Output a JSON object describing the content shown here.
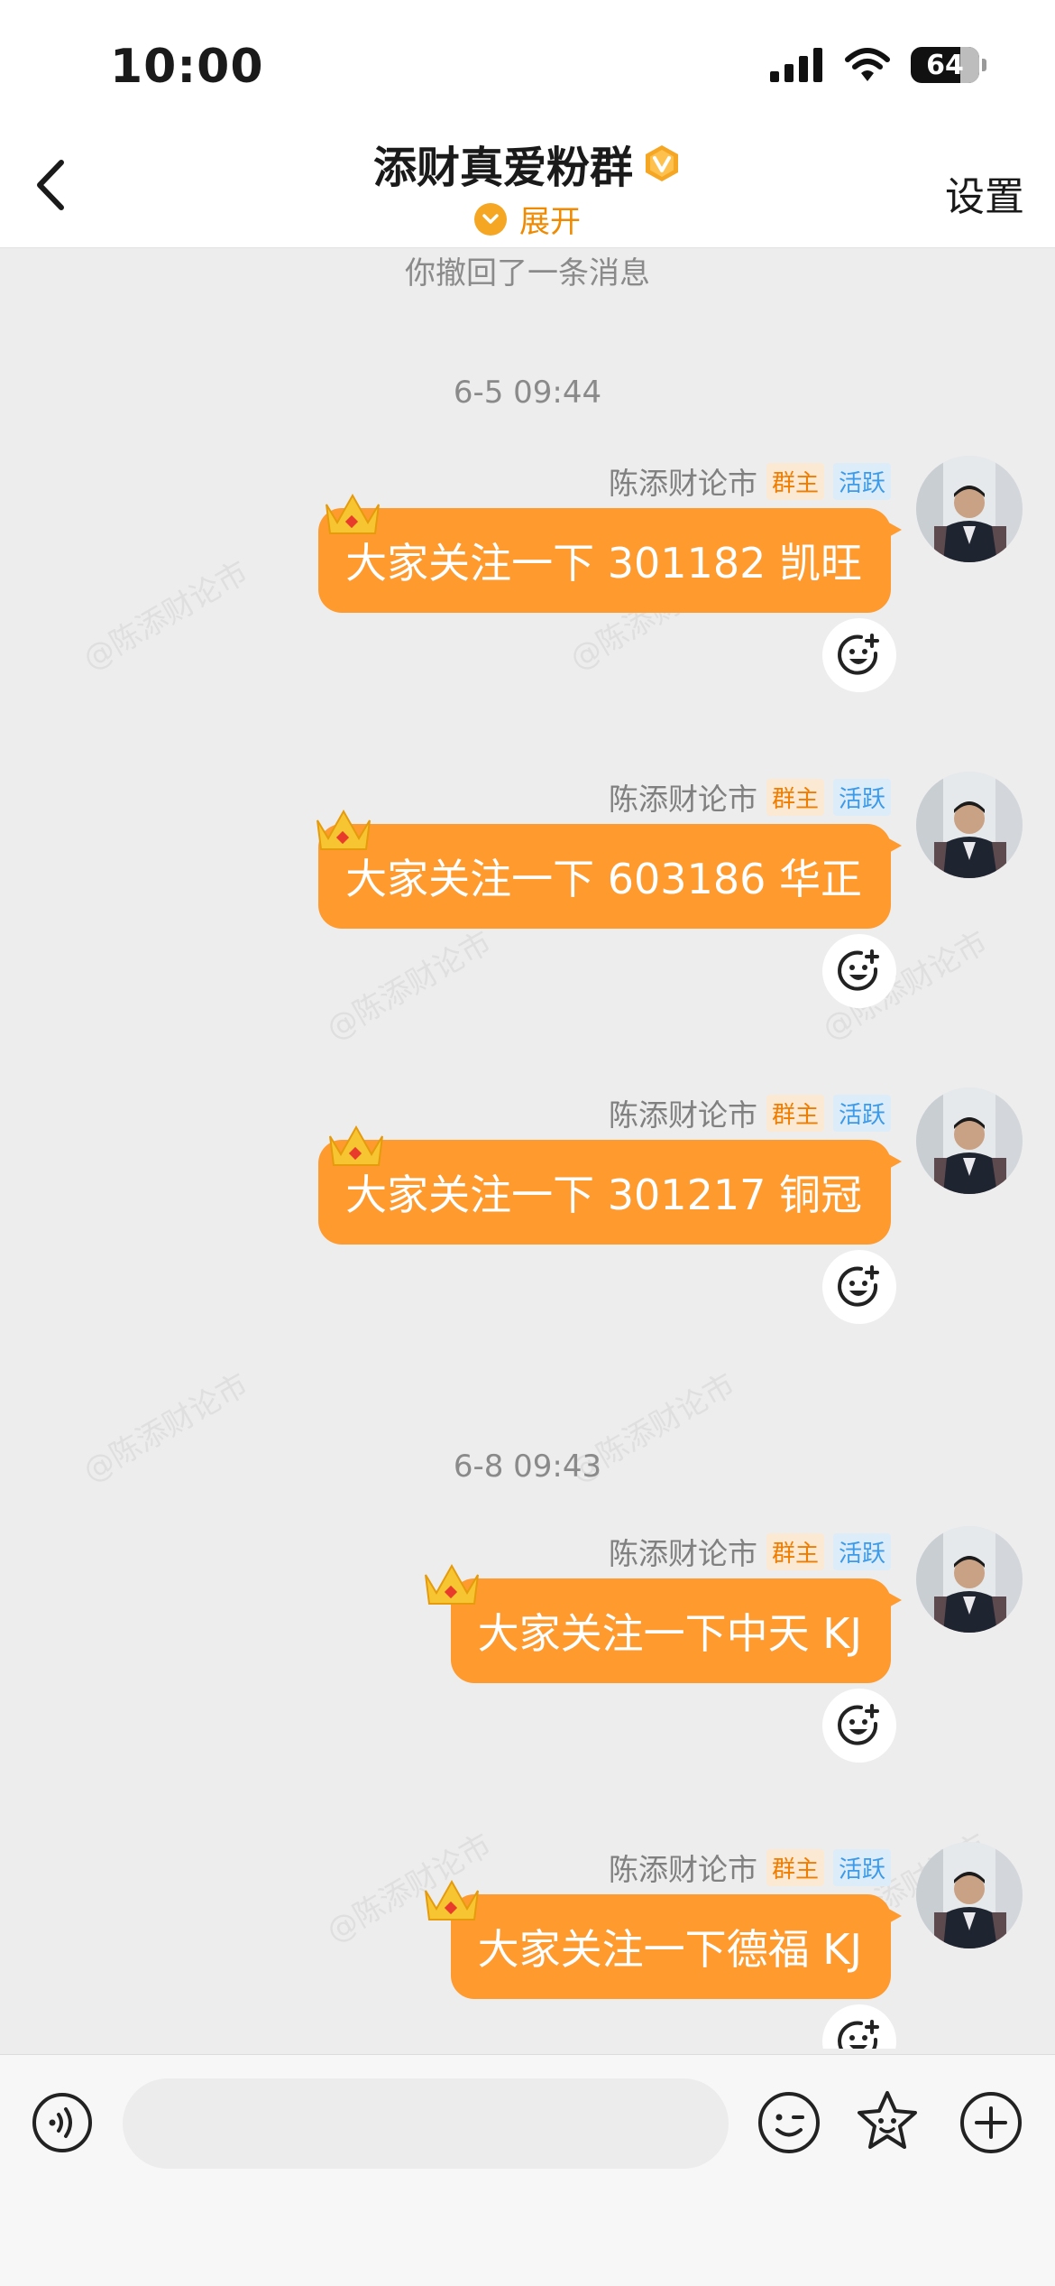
{
  "status_bar": {
    "time": "10:00",
    "battery": "64",
    "icons": [
      "signal-icon",
      "wifi-icon",
      "battery-icon"
    ]
  },
  "header": {
    "title": "添财真爱粉群",
    "expand_label": "展开",
    "settings_label": "设置",
    "back_icon": "chevron-left-icon",
    "badge_icon": "verified-v-icon"
  },
  "chat": {
    "recalled_notice": "你撤回了一条消息",
    "timestamps": [
      "6-5 09:44",
      "6-8 09:43"
    ],
    "watermark": "@陈添财论市",
    "messages": [
      {
        "sender": "陈添财论市",
        "tag_owner": "群主",
        "tag_active": "活跃",
        "text": "大家关注一下 301182 凯旺"
      },
      {
        "sender": "陈添财论市",
        "tag_owner": "群主",
        "tag_active": "活跃",
        "text": "大家关注一下 603186 华正"
      },
      {
        "sender": "陈添财论市",
        "tag_owner": "群主",
        "tag_active": "活跃",
        "text": "大家关注一下 301217 铜冠"
      },
      {
        "sender": "陈添财论市",
        "tag_owner": "群主",
        "tag_active": "活跃",
        "text": "大家关注一下中天 KJ"
      },
      {
        "sender": "陈添财论市",
        "tag_owner": "群主",
        "tag_active": "活跃",
        "text": "大家关注一下德福 KJ"
      }
    ]
  },
  "input_bar": {
    "placeholder": "",
    "icons": [
      "voice-icon",
      "emoji-icon",
      "sticker-icon",
      "plus-icon"
    ]
  },
  "colors": {
    "bubble": "#ff9a2e",
    "accent": "#f5a623",
    "owner_tag": "#f07d00",
    "active_tag": "#3b9bea"
  }
}
